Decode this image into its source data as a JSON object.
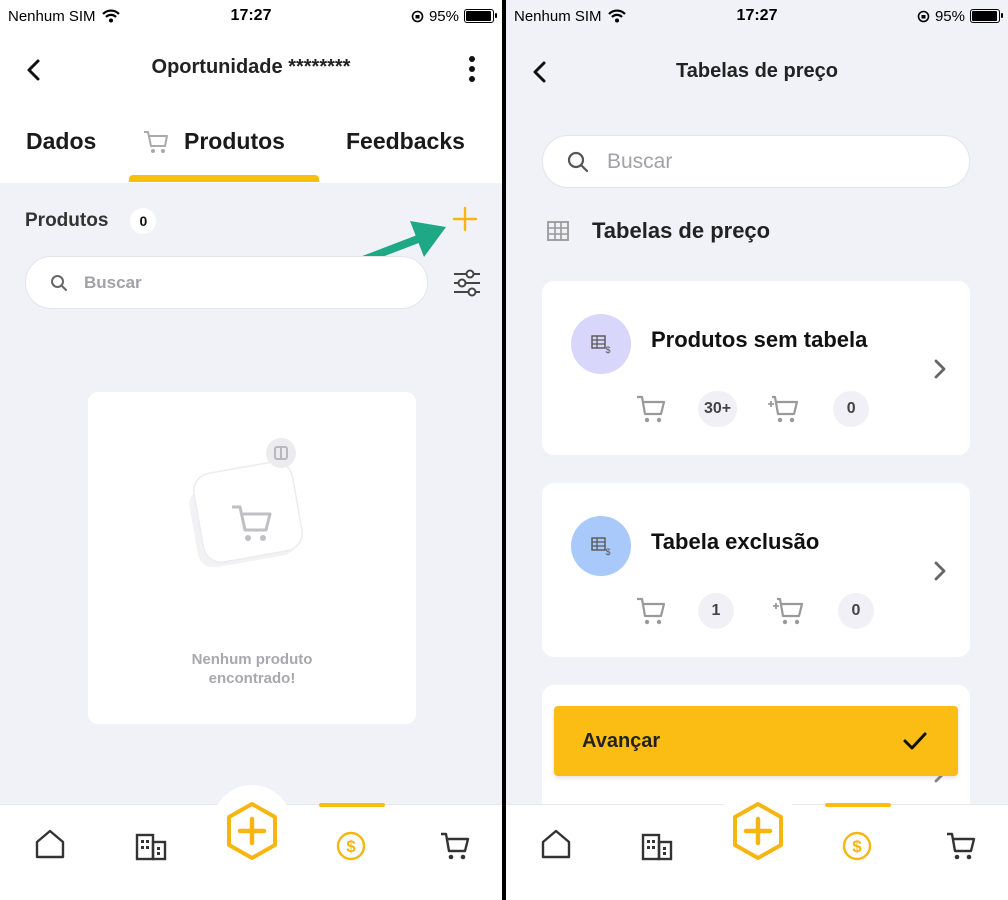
{
  "left": {
    "status": {
      "carrier": "Nenhum SIM",
      "time": "17:27",
      "battery": "95%"
    },
    "header": {
      "title": "Oportunidade ********"
    },
    "tabs": [
      {
        "label": "Dados"
      },
      {
        "label": "Produtos",
        "icon": "cart-icon",
        "active": true
      },
      {
        "label": "Feedbacks"
      }
    ],
    "section": {
      "title": "Produtos",
      "count": "0"
    },
    "search": {
      "placeholder": "Buscar"
    },
    "empty": {
      "line1": "Nenhum produto",
      "line2": "encontrado!"
    }
  },
  "right": {
    "status": {
      "carrier": "Nenhum SIM",
      "time": "17:27",
      "battery": "95%"
    },
    "header": {
      "title": "Tabelas de preço"
    },
    "search": {
      "placeholder": "Buscar"
    },
    "section": {
      "title": "Tabelas de preço"
    },
    "tables": [
      {
        "name": "Produtos sem tabela",
        "products": "30+",
        "added": "0",
        "avatar_color": "#d9d6fb"
      },
      {
        "name": "Tabela exclusão",
        "products": "1",
        "added": "0",
        "avatar_color": "#a9c9fb"
      }
    ],
    "action": {
      "label": "Avançar"
    }
  },
  "colors": {
    "accent": "#fbbd0f",
    "arrow": "#1fa886",
    "background": "#f1f1f8"
  },
  "nav_icons": [
    "home-icon",
    "building-icon",
    "add-fab-icon",
    "money-icon",
    "cart-icon"
  ]
}
